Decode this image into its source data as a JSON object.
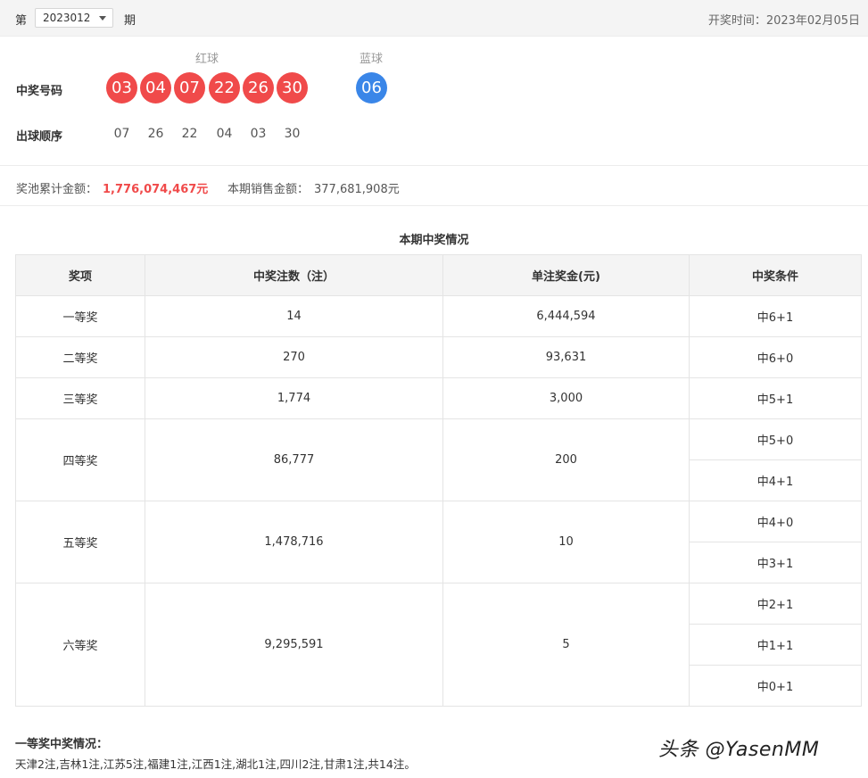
{
  "header": {
    "issue_prefix": "第",
    "issue_value": "2023012",
    "issue_suffix": "期",
    "draw_date": "开奖时间：2023年02月05日"
  },
  "numbers": {
    "red_label": "红球",
    "blue_label": "蓝球",
    "winning_label": "中奖号码",
    "red": [
      "03",
      "04",
      "07",
      "22",
      "26",
      "30"
    ],
    "blue": [
      "06"
    ],
    "order_label": "出球顺序",
    "order": [
      "07",
      "26",
      "22",
      "04",
      "03",
      "30"
    ],
    "colors": {
      "red": "#f04a4a",
      "blue": "#3a86e8"
    }
  },
  "summary": {
    "pool_label": "奖池累计金额：",
    "pool_value": "1,776,074,467元",
    "sales_label": "本期销售金额：",
    "sales_value": "377,681,908元"
  },
  "table": {
    "title": "本期中奖情况",
    "headers": [
      "奖项",
      "中奖注数（注）",
      "单注奖金(元)",
      "中奖条件"
    ],
    "rows": [
      {
        "level": "一等奖",
        "count": "14",
        "prize": "6,444,594",
        "conditions": [
          "中6+1"
        ]
      },
      {
        "level": "二等奖",
        "count": "270",
        "prize": "93,631",
        "conditions": [
          "中6+0"
        ]
      },
      {
        "level": "三等奖",
        "count": "1,774",
        "prize": "3,000",
        "conditions": [
          "中5+1"
        ]
      },
      {
        "level": "四等奖",
        "count": "86,777",
        "prize": "200",
        "conditions": [
          "中5+0",
          "中4+1"
        ]
      },
      {
        "level": "五等奖",
        "count": "1,478,716",
        "prize": "10",
        "conditions": [
          "中4+0",
          "中3+1"
        ]
      },
      {
        "level": "六等奖",
        "count": "9,295,591",
        "prize": "5",
        "conditions": [
          "中2+1",
          "中1+1",
          "中0+1"
        ]
      }
    ]
  },
  "first_prize": {
    "title": "一等奖中奖情况：",
    "text": "天津2注,吉林1注,江苏5注,福建1注,江西1注,湖北1注,四川2注,甘肃1注,共14注。"
  },
  "watermark": "头条 @YasenMM"
}
